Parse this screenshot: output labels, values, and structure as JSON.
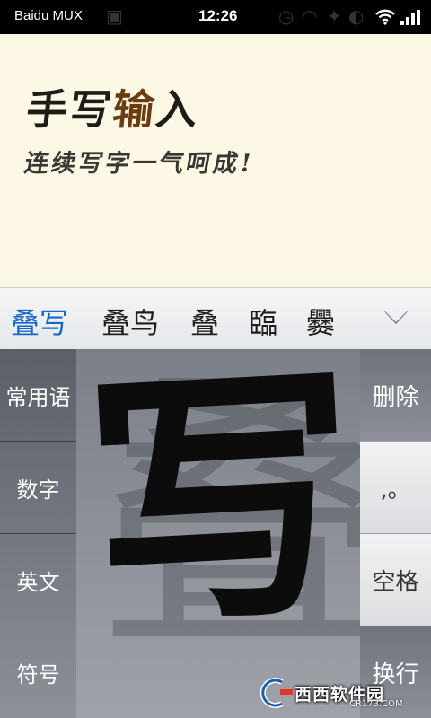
{
  "status_bar": {
    "carrier": "Baidu MUX",
    "time": "12:26"
  },
  "banner": {
    "title_part1": "手写",
    "title_part2": "输",
    "title_part3": "入",
    "subtitle": "连续写字一气呵成!"
  },
  "candidates": [
    "叠写",
    "叠鸟",
    "叠",
    "臨",
    "爨"
  ],
  "left_keys": {
    "common_phrases": "常用语",
    "numbers": "数字",
    "english": "英文",
    "symbols": "符号"
  },
  "right_keys": {
    "delete": "删除",
    "punct": ",。",
    "space": "空格",
    "newline": "换行"
  },
  "canvas": {
    "stroke_char": "写",
    "ghost_char": "叠"
  },
  "watermark": {
    "text": "西西软件园",
    "url": "CR173.COM"
  },
  "colors": {
    "active_candidate": "#1666c4",
    "banner_bg": "#fdf8e6",
    "ink": "#0c0c0c"
  }
}
